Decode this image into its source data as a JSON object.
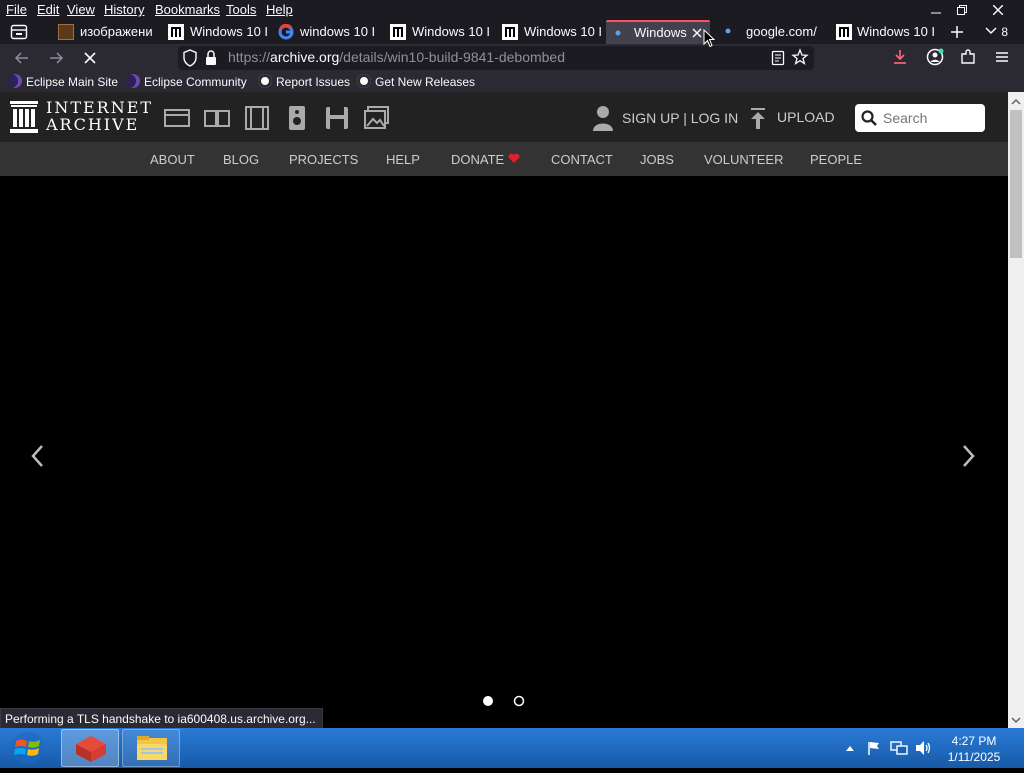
{
  "menu": [
    "File",
    "Edit",
    "View",
    "History",
    "Bookmarks",
    "Tools",
    "Help"
  ],
  "tabs": [
    {
      "label": "изображени"
    },
    {
      "label": "Windows 10 I"
    },
    {
      "label": "windows 10 I"
    },
    {
      "label": "Windows 10 I"
    },
    {
      "label": "Windows 10 I"
    },
    {
      "label": "Windows"
    },
    {
      "label": "google.com/"
    },
    {
      "label": "Windows 10 I"
    }
  ],
  "tab_overflow_count": "8",
  "url": {
    "prefix": "https://",
    "host": "archive.org",
    "path": "/details/win10-build-9841-debombed"
  },
  "bookmarks": [
    "Eclipse Main Site",
    "Eclipse Community",
    "Report Issues",
    "Get New Releases"
  ],
  "ia": {
    "logo_line1": "INTERNET",
    "logo_line2": "ARCHIVE",
    "signup": "SIGN UP | LOG IN",
    "upload": "UPLOAD",
    "search_placeholder": "Search",
    "nav": [
      "ABOUT",
      "BLOG",
      "PROJECTS",
      "HELP",
      "DONATE",
      "CONTACT",
      "JOBS",
      "VOLUNTEER",
      "PEOPLE"
    ]
  },
  "status_text": "Performing a TLS handshake to ia600408.us.archive.org...",
  "clock": {
    "time": "4:27 PM",
    "date": "1/11/2025"
  },
  "colors": {
    "active_tab_accent": "#ff4f5e",
    "taskbar": "#1b5fb4",
    "donate_heart": "#e21e2c"
  }
}
